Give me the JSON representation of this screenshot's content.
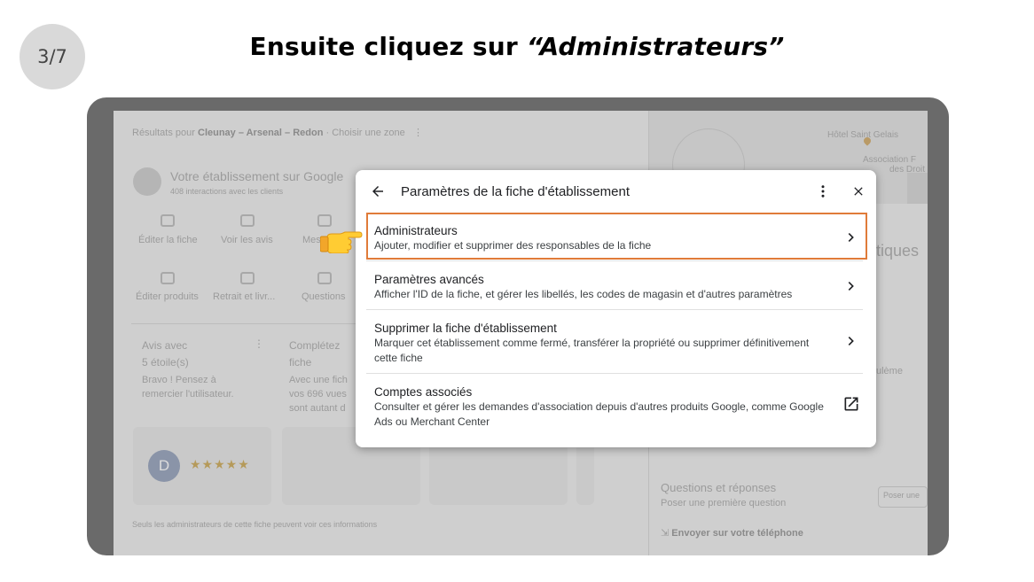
{
  "step": "3/7",
  "title": {
    "prefix": "Ensuite cliquez sur ",
    "emphasis": "“Administrateurs”"
  },
  "background": {
    "results_prefix": "Résultats pour",
    "results_place": "Cleunay – Arsenal – Redon",
    "results_link": "· Choisir une zone",
    "business_title": "Votre établissement sur Google",
    "interactions": "408 interactions avec les clients",
    "actions": [
      "Éditer la fiche",
      "Voir les avis",
      "Mess",
      "Éditer produits",
      "Retrait et livr...",
      "Questions"
    ],
    "card1_title": "Avis avec",
    "card1_title2": "5 étoile(s)",
    "card1_text": "Bravo ! Pensez à",
    "card1_text2": "remercier l'utilisateur.",
    "card2_title": "Complétez",
    "card2_title2": "fiche",
    "card2_text": "Avec une fich",
    "card2_text2": "vos 696 vues",
    "card2_text3": "sont autant d",
    "avatar_letter": "D",
    "stars": "★★★★★",
    "footer_note": "Seuls les administrateurs de cette fiche peuvent voir ces informations",
    "map_label1": "Hôtel Saint Gelais",
    "map_label2": "Association F",
    "map_label3": "des Droit",
    "right_partial1": "tiques",
    "right_partial2": "ulème",
    "qa_title": "Questions et réponses",
    "qa_link": "Poser une première question",
    "qa_button": "Poser une",
    "send_phone": "Envoyer sur votre téléphone"
  },
  "dialog": {
    "title": "Paramètres de la fiche d'établissement",
    "items": [
      {
        "title": "Administrateurs",
        "desc": "Ajouter, modifier et supprimer des responsables de la fiche",
        "icon": "chevron-right-icon"
      },
      {
        "title": "Paramètres avancés",
        "desc": "Afficher l'ID de la fiche, et gérer les libellés, les codes de magasin et d'autres paramètres",
        "icon": "chevron-right-icon"
      },
      {
        "title": "Supprimer la fiche d'établissement",
        "desc": "Marquer cet établissement comme fermé, transférer la propriété ou supprimer définitivement cette fiche",
        "icon": "chevron-right-icon"
      },
      {
        "title": "Comptes associés",
        "desc": "Consulter et gérer les demandes d'association depuis d'autres produits Google, comme Google Ads ou Merchant Center",
        "icon": "external-link-icon"
      }
    ]
  },
  "colors": {
    "highlight": "#e07b39",
    "overlay": "#cfcfcf",
    "frame": "#6a6a6a"
  }
}
